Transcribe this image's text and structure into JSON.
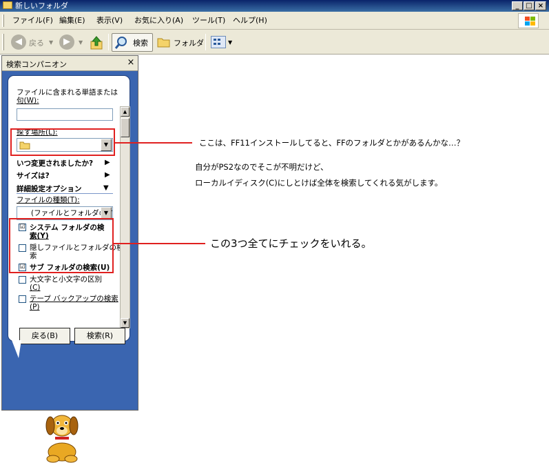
{
  "window": {
    "title": "新しいフォルダ",
    "buttons": {
      "minimize": "_",
      "maximize": "□",
      "close": "×"
    }
  },
  "menu": {
    "items": [
      "ファイル(F)",
      "編集(E)",
      "表示(V)",
      "お気に入り(A)",
      "ツール(T)",
      "ヘルプ(H)"
    ]
  },
  "toolbar": {
    "back_label": "戻る",
    "search_label": "検索",
    "folder_label": "フォルダ"
  },
  "panel": {
    "title": "検索コンパニオン",
    "close": "×",
    "words_label_1": "ファイルに含まれる単語または",
    "words_label_2": "句(W):",
    "words_value": "",
    "lookin_label": "探す場所(L):",
    "lookin_value": "",
    "modified_label": "いつ変更されましたか?",
    "size_label": "サイズは?",
    "advanced_label": "詳細設定オプション",
    "filetype_label": "ファイルの種類(T):",
    "filetype_value": "(ファイルとフォルダのす",
    "options": [
      {
        "label_1": "システム フォルダの検",
        "label_2": "索(Y)",
        "checked": true,
        "bold": true
      },
      {
        "label_1": "隠しファイルとフォルダの検",
        "label_2": "索",
        "checked": false,
        "bold": false
      },
      {
        "label_1": "サブ フォルダの検索(U)",
        "label_2": "",
        "checked": true,
        "bold": true
      },
      {
        "label_1": "大文字と小文字の区別",
        "label_2": "(C)",
        "checked": false,
        "bold": false
      },
      {
        "label_1": "テープ バックアップの検索",
        "label_2": "(P)",
        "checked": false,
        "bold": false
      }
    ],
    "check_mark": "☑",
    "back_button": "戻る(B)",
    "search_button": "検索(R)"
  },
  "annotations": {
    "note1": "ここは、FF11インストールしてると、FFのフォルダとかがあるんかな…？",
    "note2": "自分がPS2なのでそこが不明だけど、",
    "note3": "ローカルイディスク(C)にしとけば全体を検索してくれる気がします。",
    "note4": "この3つ全てにチェックをいれる。"
  },
  "colors": {
    "annotation_red": "#e0201f",
    "panel_blue": "#3a65b0",
    "titlebar": "#0a246a"
  }
}
